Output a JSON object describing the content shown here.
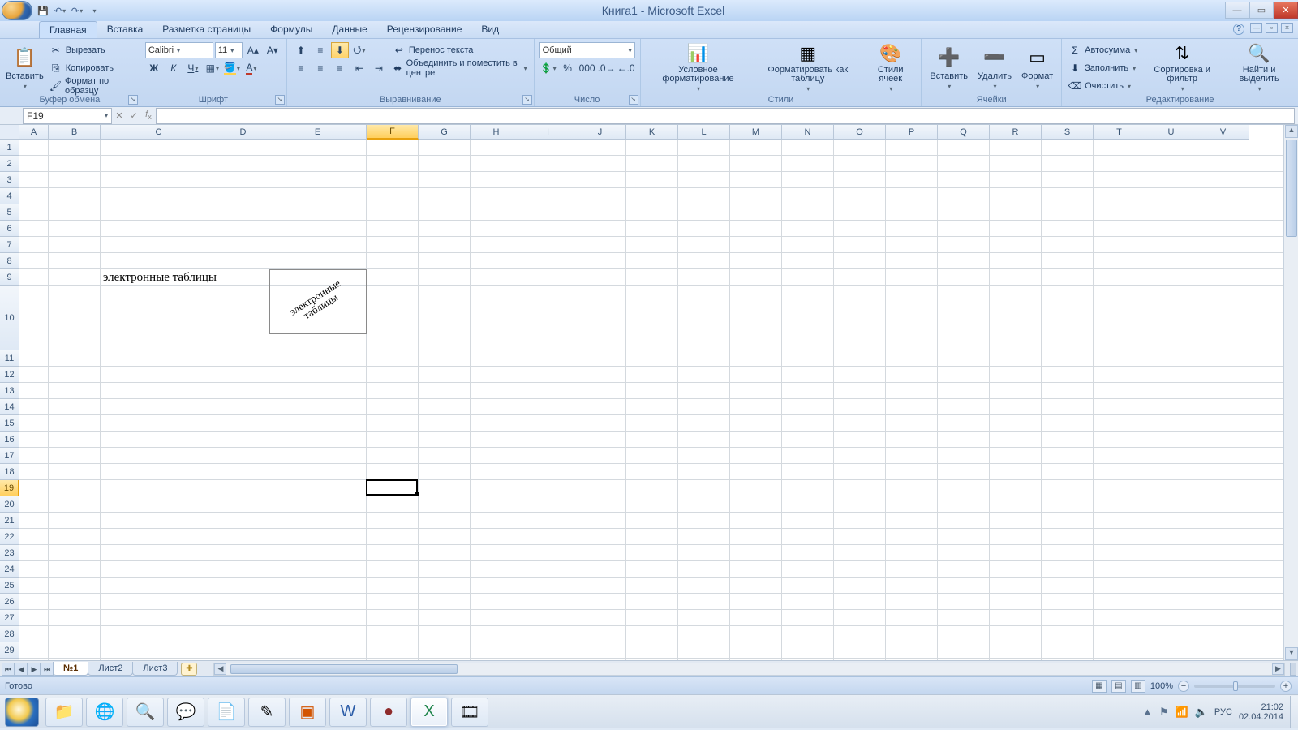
{
  "title": "Книга1 - Microsoft Excel",
  "tabs": [
    "Главная",
    "Вставка",
    "Разметка страницы",
    "Формулы",
    "Данные",
    "Рецензирование",
    "Вид"
  ],
  "active_tab": 0,
  "clipboard": {
    "label": "Буфер обмена",
    "paste": "Вставить",
    "cut": "Вырезать",
    "copy": "Копировать",
    "fmtpainter": "Формат по образцу"
  },
  "font": {
    "label": "Шрифт",
    "name": "Calibri",
    "size": "11",
    "bold": "Ж",
    "italic": "К",
    "underline": "Ч"
  },
  "align": {
    "label": "Выравнивание",
    "wrap": "Перенос текста",
    "merge": "Объединить и поместить в центре"
  },
  "number": {
    "label": "Число",
    "format": "Общий"
  },
  "styles": {
    "label": "Стили",
    "cond": "Условное форматирование",
    "table": "Форматировать как таблицу",
    "cell": "Стили ячеек"
  },
  "cells": {
    "label": "Ячейки",
    "insert": "Вставить",
    "delete": "Удалить",
    "format": "Формат"
  },
  "editing": {
    "label": "Редактирование",
    "sum": "Автосумма",
    "fill": "Заполнить",
    "clear": "Очистить",
    "sort": "Сортировка и фильтр",
    "find": "Найти и выделить"
  },
  "namebox": "F19",
  "columns": [
    "A",
    "B",
    "C",
    "D",
    "E",
    "F",
    "G",
    "H",
    "I",
    "J",
    "K",
    "L",
    "M",
    "N",
    "O",
    "P",
    "Q",
    "R",
    "S",
    "T",
    "U",
    "V"
  ],
  "rows_count": 30,
  "active_col_index": 5,
  "active_row_index": 18,
  "row_heights": {
    "9": 80
  },
  "col_widths": {
    "0": 36,
    "1": 64,
    "2": 144,
    "3": 64,
    "4": 120,
    "5": 64
  },
  "cell_text": {
    "c9": "электронные таблицы",
    "e10_rotated": "электронные\nтаблицы"
  },
  "sheets": [
    "№1",
    "Лист2",
    "Лист3"
  ],
  "active_sheet": 0,
  "status": "Готово",
  "zoom": "100%",
  "lang": "РУС",
  "time": "21:02",
  "date": "02.04.2014"
}
